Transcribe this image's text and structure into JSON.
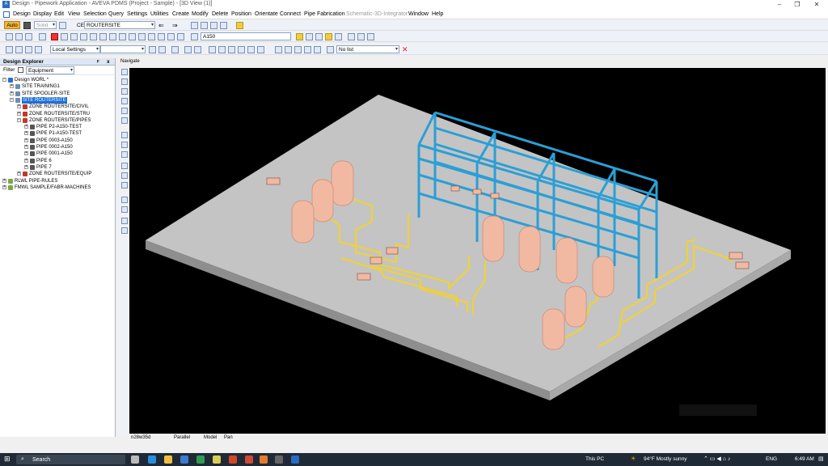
{
  "titlebar": {
    "app_icon": "A",
    "title": "Design - Pipework Application - AVEVA PDMS (Project - Sample) - [3D View (1)]",
    "minimize": "–",
    "restore": "❐",
    "close": "✕"
  },
  "menu": [
    "Design",
    "Display",
    "Edit",
    "View",
    "Selection",
    "Query",
    "Settings",
    "Utilities",
    "Create",
    "Modify",
    "Delete",
    "Position",
    "Orientate",
    "Connect",
    "Pipe Fabrication",
    "Schematic-3D-Integrator",
    "Window",
    "Help"
  ],
  "toolbar1": {
    "auto_label": "Auto",
    "solid_label": "Solid",
    "ce_label": "CE",
    "ce_value": "ROUTERSITE"
  },
  "toolbar2": {
    "pipe_spec_value": "A150"
  },
  "toolbar3": {
    "local_settings_value": "Local Settings",
    "list_value": "No list"
  },
  "explorer": {
    "title": "Design Explorer",
    "pin": "ᵖ",
    "close": "x",
    "filter_label": "Filter",
    "filter_value": "Equipment",
    "tree": [
      {
        "label": "Design WORL *",
        "level": 0,
        "expander": "−",
        "icon": "world-icon",
        "color": "#2b6cd1"
      },
      {
        "label": "SITE TRAINING1",
        "level": 1,
        "expander": "+",
        "icon": "site-icon",
        "color": "#6b8cb3"
      },
      {
        "label": "SITE SPOOLER-SITE",
        "level": 1,
        "expander": "+",
        "icon": "site-icon",
        "color": "#6b8cb3"
      },
      {
        "label": "SITE ROUTERSITE",
        "level": 1,
        "expander": "−",
        "icon": "site-icon",
        "color": "#6b8cb3",
        "selected": true
      },
      {
        "label": "ZONE ROUTERSITE/CIVIL",
        "level": 2,
        "expander": "+",
        "icon": "zone-icon",
        "color": "#c0392b"
      },
      {
        "label": "ZONE ROUTERSITE/STRU",
        "level": 2,
        "expander": "+",
        "icon": "zone-icon",
        "color": "#c0392b"
      },
      {
        "label": "ZONE ROUTERSITE/PIPES",
        "level": 2,
        "expander": "−",
        "icon": "zone-icon",
        "color": "#c0392b"
      },
      {
        "label": "PIPE P2-A150-TEST",
        "level": 3,
        "expander": "+",
        "icon": "pipe-icon",
        "color": "#555"
      },
      {
        "label": "PIPE P1-A150-TEST",
        "level": 3,
        "expander": "+",
        "icon": "pipe-icon",
        "color": "#555"
      },
      {
        "label": "PIPE 0003-A150",
        "level": 3,
        "expander": "+",
        "icon": "pipe-icon",
        "color": "#555"
      },
      {
        "label": "PIPE 0002-A150",
        "level": 3,
        "expander": "+",
        "icon": "pipe-icon",
        "color": "#555"
      },
      {
        "label": "PIPE 0001-A150",
        "level": 3,
        "expander": "+",
        "icon": "pipe-icon",
        "color": "#555"
      },
      {
        "label": "PIPE 6",
        "level": 3,
        "expander": "+",
        "icon": "pipe-icon",
        "color": "#555"
      },
      {
        "label": "PIPE 7",
        "level": 3,
        "expander": "+",
        "icon": "pipe-icon",
        "color": "#555"
      },
      {
        "label": "ZONE ROUTERSITE/EQUIP",
        "level": 2,
        "expander": "+",
        "icon": "zone-icon",
        "color": "#c0392b"
      },
      {
        "label": "RLWL PIPE-RULES",
        "level": 0,
        "expander": "+",
        "icon": "rules-icon",
        "color": "#7a4"
      },
      {
        "label": "FMWL SAMPLE/FABR-MACHINES",
        "level": 0,
        "expander": "+",
        "icon": "machines-icon",
        "color": "#7a4"
      }
    ]
  },
  "navigate_label": "Navigate",
  "view": {
    "background": "#000000",
    "slab_color": "#c4c4c4",
    "steel_color": "#2b9fd6",
    "vessel_color": "#f1b9a2",
    "pipe_color": "#f2d22e"
  },
  "status": {
    "coords": "n28w35d",
    "projection": "Parallel",
    "mode": "Model",
    "action": "Pan"
  },
  "taskbar": {
    "search_label": "Search",
    "this_pc": "This PC",
    "weather": "94°F  Mostly sunny",
    "lang": "ENG",
    "time": "6:49 AM"
  }
}
